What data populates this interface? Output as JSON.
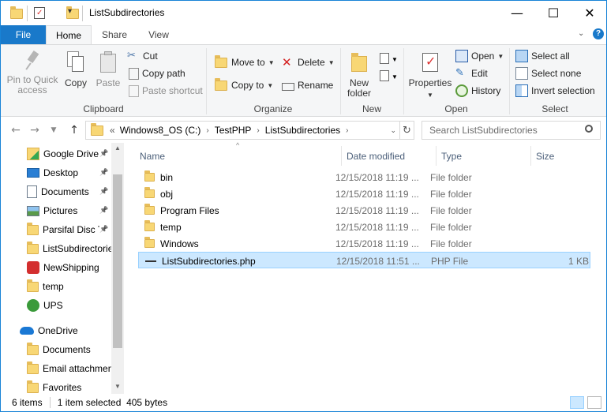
{
  "window": {
    "title": "ListSubdirectories"
  },
  "tabs": {
    "file": "File",
    "home": "Home",
    "share": "Share",
    "view": "View"
  },
  "ribbon": {
    "clipboard": {
      "label": "Clipboard",
      "pin": "Pin to Quick access",
      "copy": "Copy",
      "paste": "Paste",
      "cut": "Cut",
      "copy_path": "Copy path",
      "paste_shortcut": "Paste shortcut"
    },
    "organize": {
      "label": "Organize",
      "move_to": "Move to",
      "copy_to": "Copy to",
      "delete": "Delete",
      "rename": "Rename"
    },
    "new": {
      "label": "New",
      "new_folder": "New folder"
    },
    "open": {
      "label": "Open",
      "properties": "Properties",
      "open": "Open",
      "edit": "Edit",
      "history": "History"
    },
    "select": {
      "label": "Select",
      "select_all": "Select all",
      "select_none": "Select none",
      "invert": "Invert selection"
    }
  },
  "address": {
    "prefix": "«",
    "crumbs": [
      "Windows8_OS (C:)",
      "TestPHP",
      "ListSubdirectories"
    ],
    "search_placeholder": "Search ListSubdirectories"
  },
  "nav": [
    {
      "label": "Google Drive",
      "icon": "google-drive-icon",
      "pinned": true
    },
    {
      "label": "Desktop",
      "icon": "desktop-icon",
      "pinned": true
    },
    {
      "label": "Documents",
      "icon": "documents-icon",
      "pinned": true
    },
    {
      "label": "Pictures",
      "icon": "pictures-icon",
      "pinned": true
    },
    {
      "label": "Parsifal Disc Tr",
      "icon": "folder-icon",
      "pinned": true
    },
    {
      "label": "ListSubdirectories",
      "icon": "folder-icon",
      "pinned": false
    },
    {
      "label": "NewShipping",
      "icon": "newshipping-icon",
      "pinned": false
    },
    {
      "label": "temp",
      "icon": "folder-icon",
      "pinned": false
    },
    {
      "label": "UPS",
      "icon": "ups-icon",
      "pinned": false
    },
    {
      "label": "OneDrive",
      "icon": "onedrive-icon",
      "pinned": false
    },
    {
      "label": "Documents",
      "icon": "folder-icon",
      "pinned": false
    },
    {
      "label": "Email attachments",
      "icon": "folder-icon",
      "pinned": false
    },
    {
      "label": "Favorites",
      "icon": "folder-icon",
      "pinned": false
    }
  ],
  "columns": {
    "name": "Name",
    "date": "Date modified",
    "type": "Type",
    "size": "Size"
  },
  "files": [
    {
      "name": "bin",
      "date": "12/15/2018 11:19 ...",
      "type": "File folder",
      "size": "",
      "icon": "folder-icon"
    },
    {
      "name": "obj",
      "date": "12/15/2018 11:19 ...",
      "type": "File folder",
      "size": "",
      "icon": "folder-icon"
    },
    {
      "name": "Program Files",
      "date": "12/15/2018 11:19 ...",
      "type": "File folder",
      "size": "",
      "icon": "folder-icon"
    },
    {
      "name": "temp",
      "date": "12/15/2018 11:19 ...",
      "type": "File folder",
      "size": "",
      "icon": "folder-icon"
    },
    {
      "name": "Windows",
      "date": "12/15/2018 11:19 ...",
      "type": "File folder",
      "size": "",
      "icon": "folder-icon"
    },
    {
      "name": "ListSubdirectories.php",
      "date": "12/15/2018 11:51 ...",
      "type": "PHP File",
      "size": "1 KB",
      "icon": "php-file-icon",
      "selected": true
    }
  ],
  "status": {
    "count": "6 items",
    "selection": "1 item selected  405 bytes"
  },
  "colors": {
    "accent": "#1979ca",
    "selection": "#cce8ff",
    "folder": "#f8d775"
  }
}
